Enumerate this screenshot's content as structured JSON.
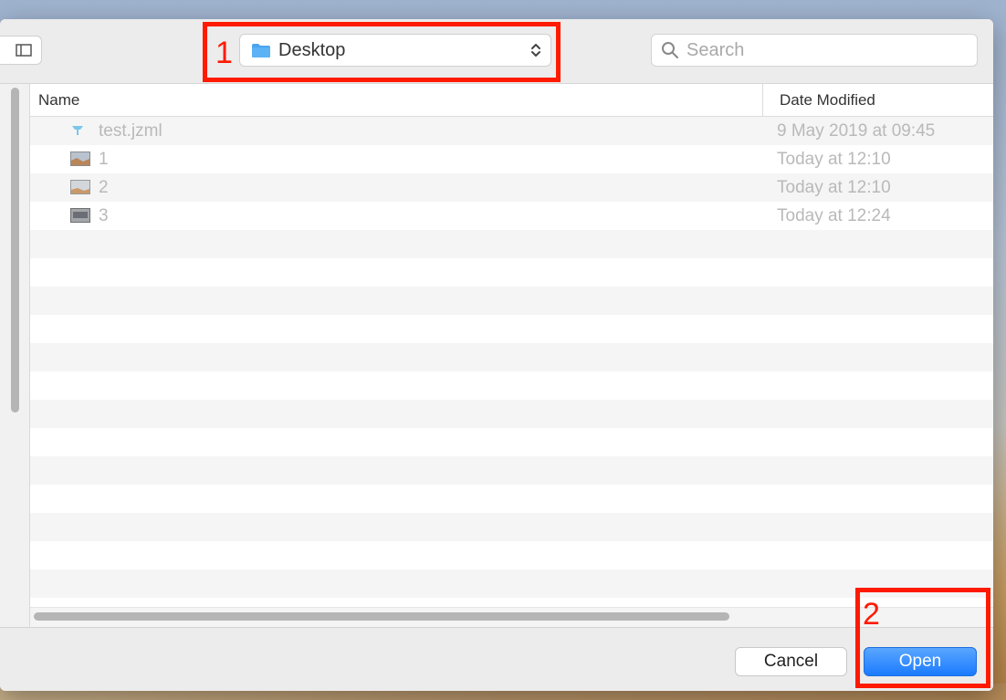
{
  "dialog": {
    "location": {
      "label": "Desktop",
      "folder_color": "#4aa3f0"
    },
    "search": {
      "placeholder": "Search",
      "value": ""
    },
    "columns": {
      "name": "Name",
      "date_modified": "Date Modified"
    },
    "files": [
      {
        "name": "test.jzml",
        "date": "9 May 2019 at 09:45",
        "icon": "jzml-file-icon"
      },
      {
        "name": "1",
        "date": "Today at 12:10",
        "icon": "image-thumbnail-icon"
      },
      {
        "name": "2",
        "date": "Today at 12:10",
        "icon": "image-thumbnail-icon"
      },
      {
        "name": "3",
        "date": "Today at 12:24",
        "icon": "image-thumbnail-icon"
      }
    ],
    "buttons": {
      "cancel": "Cancel",
      "open": "Open"
    }
  },
  "annotations": {
    "marker_1": "1",
    "marker_2": "2",
    "color": "#ff1a00"
  },
  "colors": {
    "accent_blue": "#1b7bff"
  }
}
